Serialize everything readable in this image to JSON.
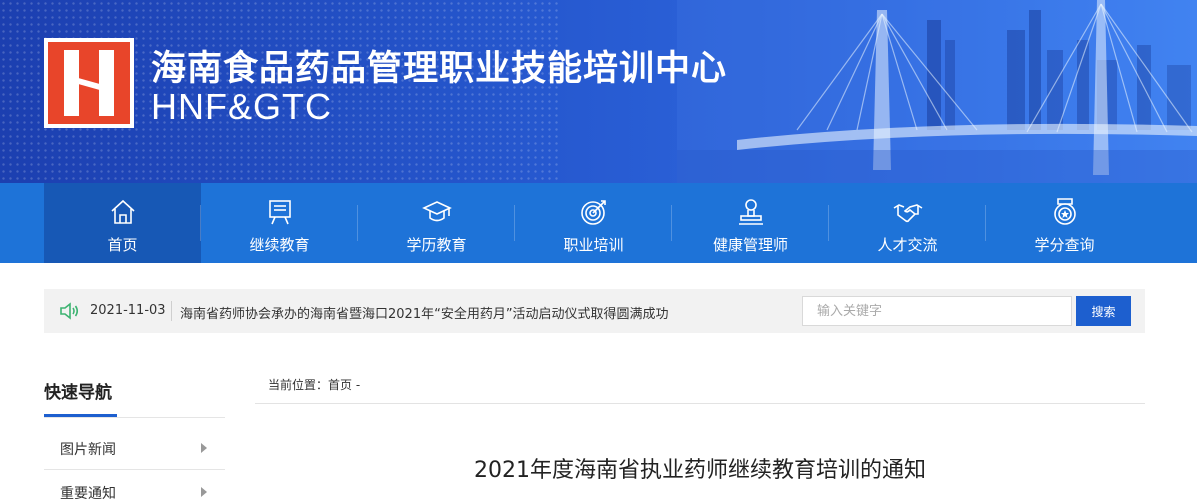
{
  "header": {
    "title": "海南食品药品管理职业技能培训中心",
    "subtitle": "HNF&GTC",
    "logo_icon": "hnfgtc-logo-icon",
    "colors": {
      "banner_start": "#1c3fb0",
      "banner_end": "#3b7ff0",
      "logo_red": "#e8452a"
    }
  },
  "nav": {
    "items": [
      {
        "label": "首页",
        "icon": "home-icon",
        "active": true
      },
      {
        "label": "继续教育",
        "icon": "board-icon"
      },
      {
        "label": "学历教育",
        "icon": "graduation-cap-icon"
      },
      {
        "label": "职业培训",
        "icon": "target-icon"
      },
      {
        "label": "健康管理师",
        "icon": "person-icon"
      },
      {
        "label": "人才交流",
        "icon": "handshake-icon"
      },
      {
        "label": "学分查询",
        "icon": "medal-icon"
      }
    ],
    "colors": {
      "background": "#1e73d8",
      "active": "#1758b5"
    }
  },
  "ticker": {
    "icon": "speaker-icon",
    "date": "2021-11-03",
    "text": "海南省药师协会承办的海南省暨海口2021年“安全用药月”活动启动仪式取得圆满成功"
  },
  "search": {
    "placeholder": "输入关键字",
    "value": "",
    "button_label": "搜索"
  },
  "sidebar": {
    "title": "快速导航",
    "items": [
      {
        "label": "图片新闻"
      },
      {
        "label": "重要通知"
      }
    ]
  },
  "content": {
    "breadcrumb": "当前位置：首页 -",
    "article_title": "2021年度海南省执业药师继续教育培训的通知"
  }
}
